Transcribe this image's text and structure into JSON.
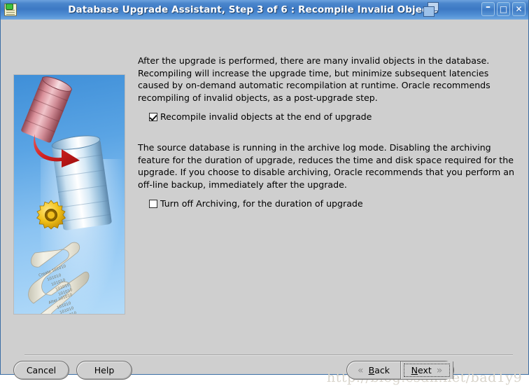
{
  "window": {
    "title": "Database Upgrade Assistant, Step 3 of 6 : Recompile Invalid Objects",
    "icon": "database-upgrade-icon",
    "overlay_icon": "cascade-windows-icon",
    "controls": {
      "minimize": "–",
      "maximize": "□",
      "close": "✕"
    },
    "titlebar_color": "#3d79c4",
    "background_color": "#cfcfcf"
  },
  "illustration": {
    "name": "database-upgrade-illustration",
    "scroll_labels": {
      "create": "Create",
      "alter": "Alter",
      "binary": "101010"
    },
    "colors": {
      "sky": "#5aa4e4",
      "red_cylinder": "#d98f99",
      "blue_cylinder": "#cfe4f2",
      "gear": "#f5c518",
      "arrow": "#d32020"
    }
  },
  "content": {
    "paragraph1": "After the upgrade is performed, there are many invalid objects in the database. Recompiling will increase the upgrade time, but minimize subsequent latencies caused by on-demand automatic recompilation at runtime. Oracle recommends recompiling of invalid objects, as a post-upgrade step.",
    "checkbox1": {
      "label": "Recompile invalid objects at the end of upgrade",
      "checked": true
    },
    "paragraph2": "The source database is running in the archive log mode. Disabling the archiving feature for the duration of upgrade, reduces the time and disk space required for the upgrade. If you choose to disable archiving, Oracle recommends that you perform an off-line backup, immediately after the upgrade.",
    "checkbox2": {
      "label": "Turn off Archiving, for the duration of upgrade",
      "checked": false
    }
  },
  "buttons": {
    "cancel": "Cancel",
    "help": "Help",
    "back": "Back",
    "back_mnemonic": "B",
    "back_rest": "ack",
    "next": "Next",
    "next_mnemonic": "N",
    "next_rest": "ext",
    "back_arrow": "«",
    "next_arrow": "»"
  },
  "watermark": "http://blog.csdn.net/bad1y9"
}
